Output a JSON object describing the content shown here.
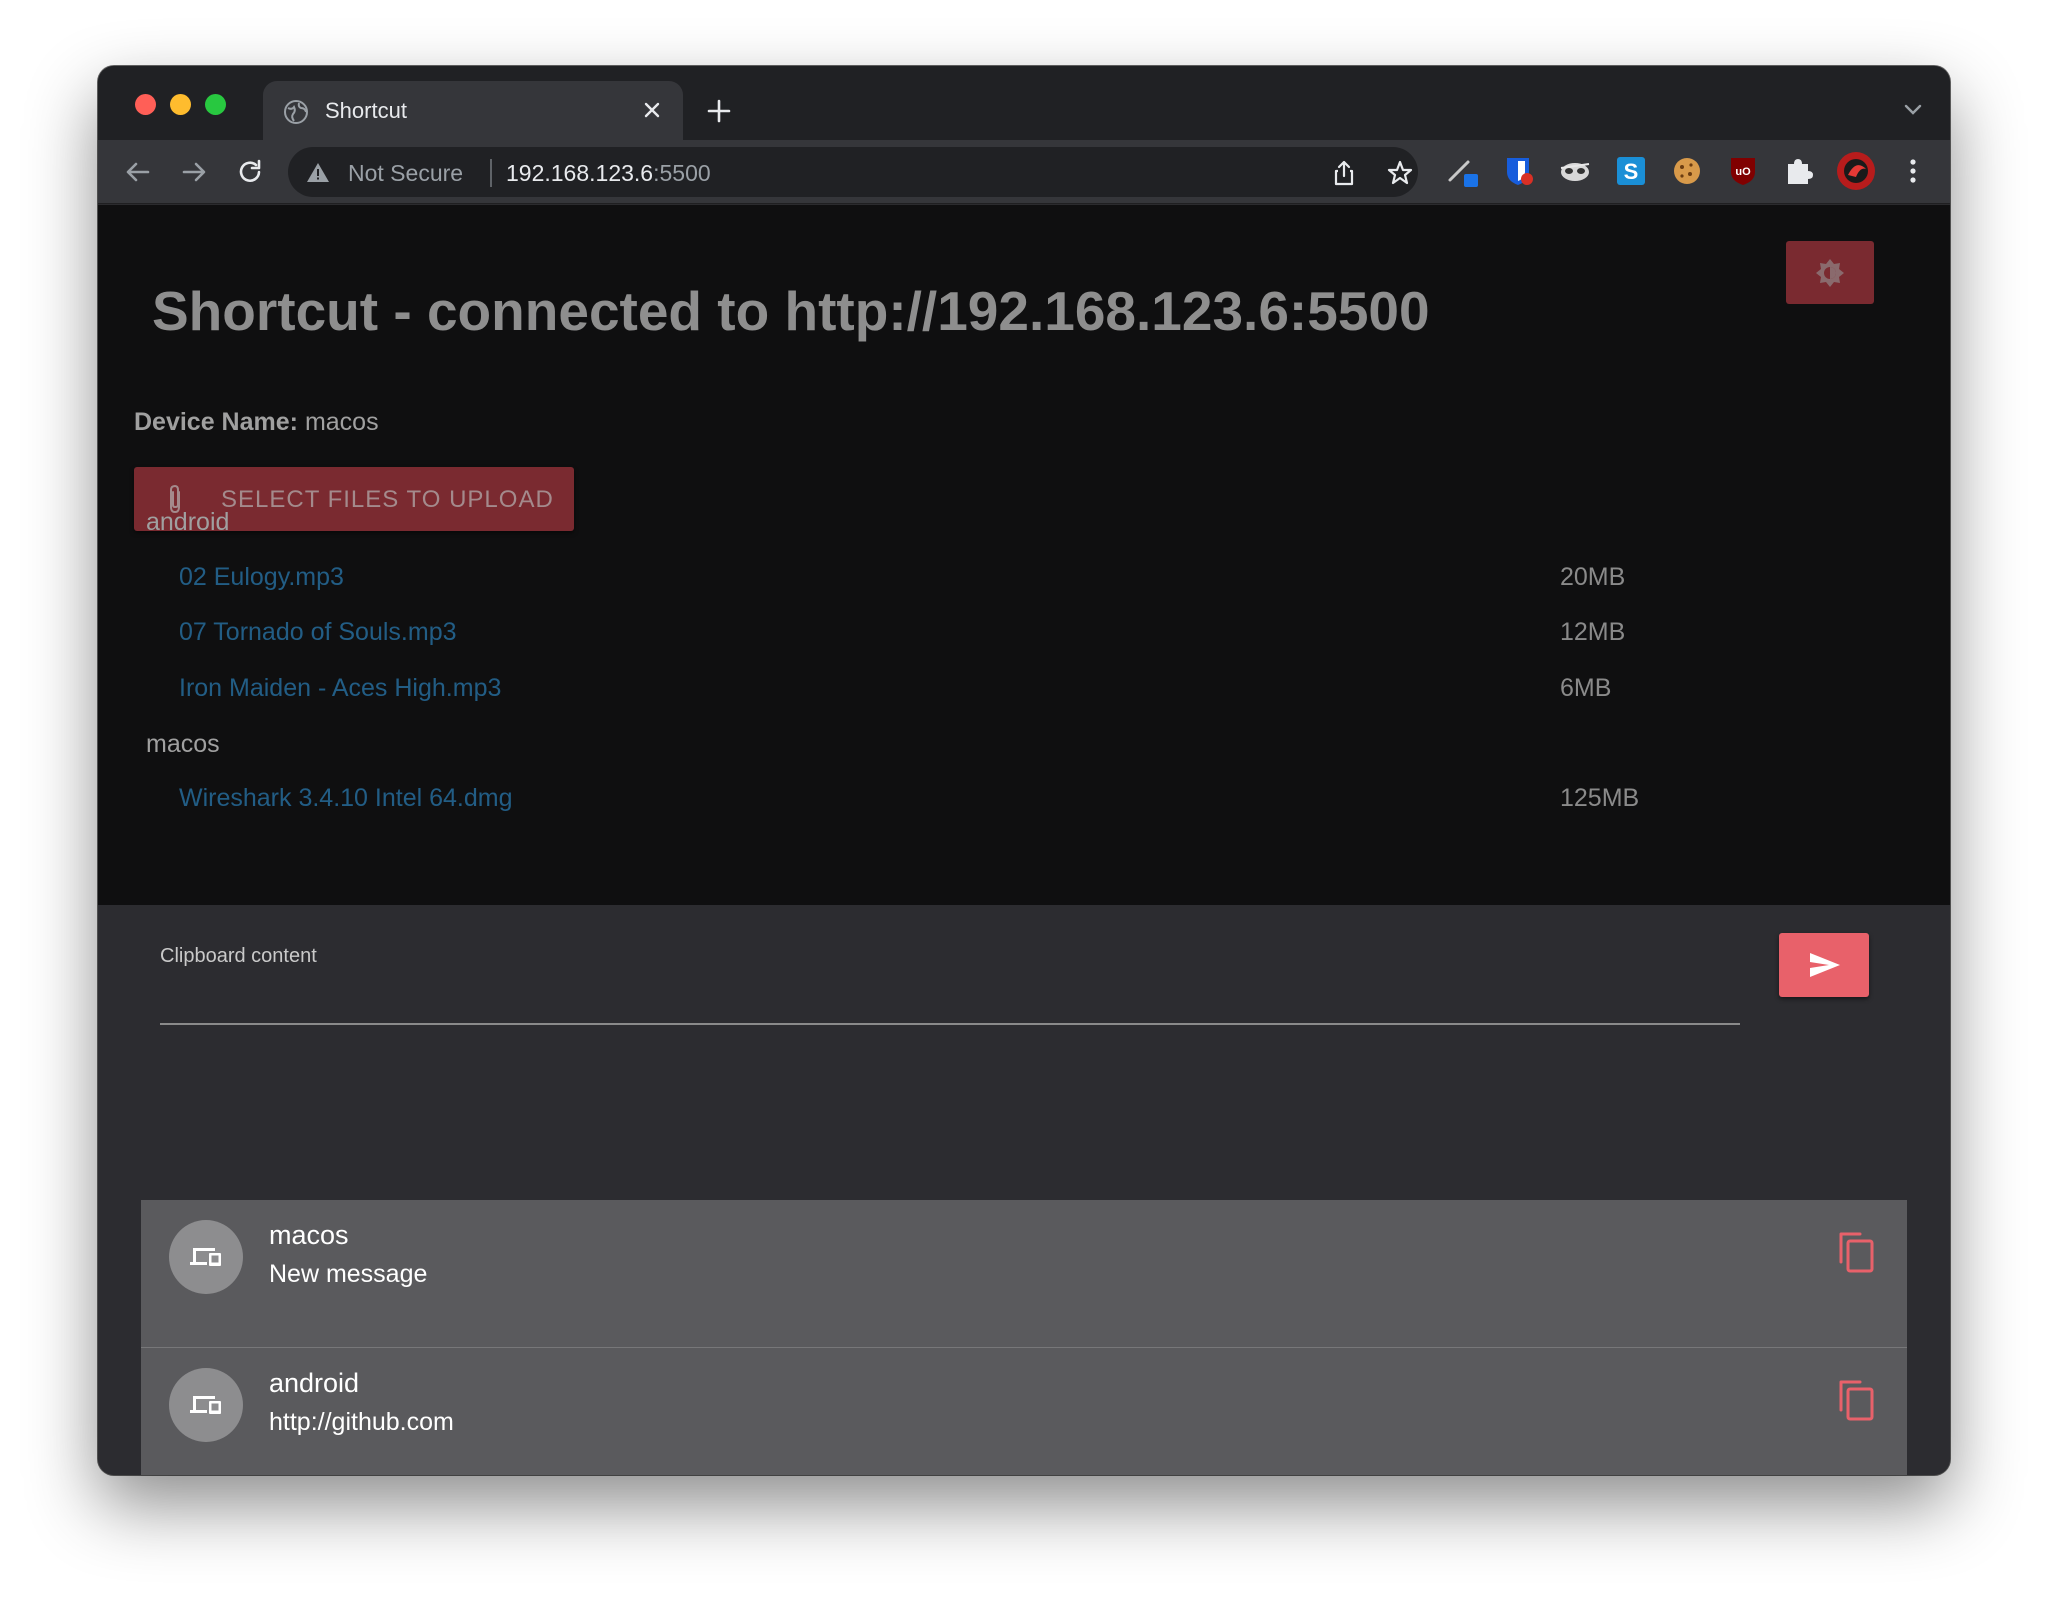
{
  "browser": {
    "tab": {
      "title": "Shortcut"
    },
    "address": {
      "security_label": "Not Secure",
      "host": "192.168.123.6",
      "port": ":5500"
    }
  },
  "page": {
    "title": "Shortcut - connected to http://192.168.123.6:5500",
    "device_label": "Device Name:",
    "device_name": "macos",
    "upload_button": "SELECT FILES TO UPLOAD",
    "file_groups": [
      {
        "name": "android",
        "files": [
          {
            "name": "02 Eulogy.mp3",
            "size": "20MB"
          },
          {
            "name": "07 Tornado of Souls.mp3",
            "size": "12MB"
          },
          {
            "name": "Iron Maiden - Aces High.mp3",
            "size": "6MB"
          }
        ]
      },
      {
        "name": "macos",
        "files": [
          {
            "name": "Wireshark 3.4.10 Intel 64.dmg",
            "size": "125MB"
          }
        ]
      }
    ],
    "clipboard": {
      "label": "Clipboard content",
      "value": ""
    },
    "messages": [
      {
        "sender": "macos",
        "text": "New message"
      },
      {
        "sender": "android",
        "text": "http://github.com"
      }
    ]
  },
  "colors": {
    "accent": "#e8616a",
    "accent_dim": "#7a2a30",
    "link": "#225d85",
    "page_bg": "#0f0f10",
    "card_bg": "#5a5a5d"
  }
}
